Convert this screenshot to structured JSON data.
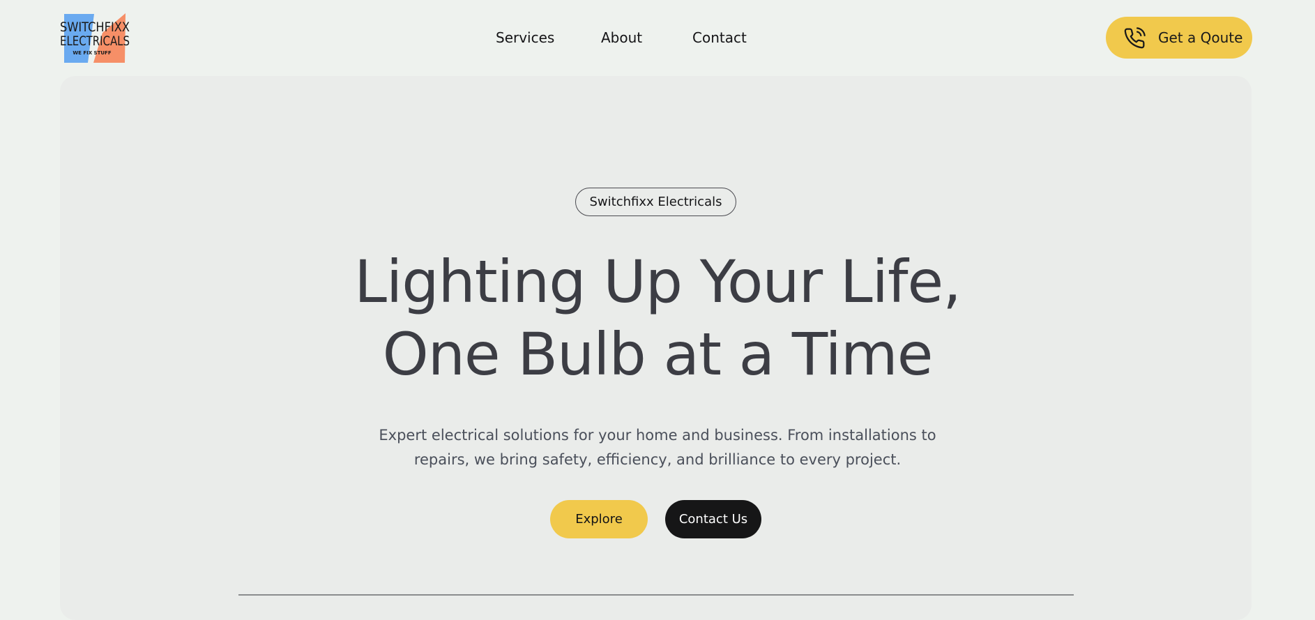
{
  "header": {
    "logo": {
      "line1": "SWITCHFIXX",
      "line2": "ELECTRICALS",
      "tagline": "WE FIX STUFF",
      "colors": {
        "blue": "#6aaaf0",
        "orange": "#f68f67",
        "text": "#1a1a1a"
      }
    },
    "nav": [
      {
        "label": "Services"
      },
      {
        "label": "About"
      },
      {
        "label": "Contact"
      }
    ],
    "cta": {
      "label": "Get a Qoute",
      "icon": "phone-call-icon",
      "color": "#f1c94c"
    }
  },
  "hero": {
    "badge": "Switchfixx Electricals",
    "headline": {
      "line1": "Lighting Up Your Life,",
      "line2": "One Bulb at a Time"
    },
    "subtext": {
      "line1": "Expert electrical solutions for your home and business. From installations to",
      "line2": "repairs, we bring safety, efficiency, and brilliance to every project."
    },
    "buttons": {
      "explore": "Explore",
      "contact": "Contact Us"
    },
    "colors": {
      "accent": "#f1c94c",
      "dark": "#161617",
      "panel": "#eaecea",
      "page": "#eef2ee",
      "headline": "#3c3d44"
    }
  }
}
